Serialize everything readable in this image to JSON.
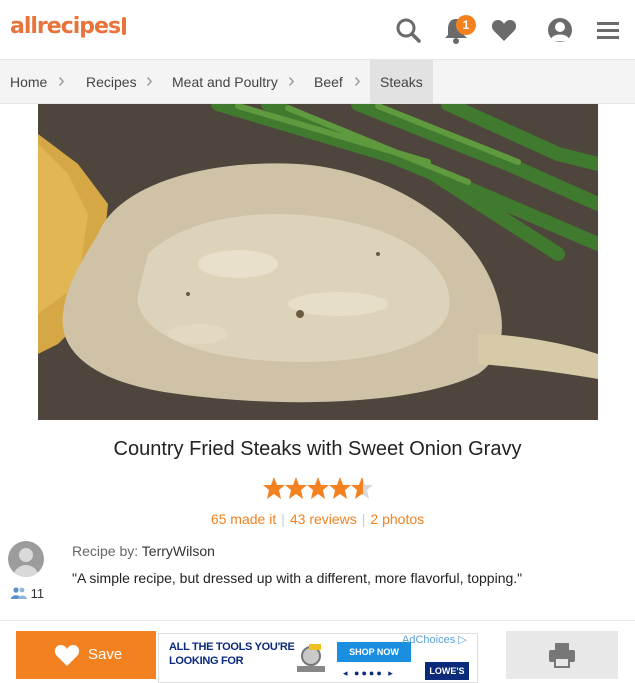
{
  "header": {
    "logo_text": "allrecipes",
    "notification_count": "1",
    "icons": [
      "search-icon",
      "bell-icon",
      "heart-icon",
      "user-icon",
      "menu-icon"
    ],
    "accent_color": "#f48120"
  },
  "breadcrumb": {
    "items": [
      "Home",
      "Recipes",
      "Meat and Poultry",
      "Beef",
      "Steaks"
    ]
  },
  "recipe": {
    "title": "Country Fried Steaks with Sweet Onion Gravy",
    "rating": 4.5,
    "made_it": "65 made it",
    "reviews": "43 reviews",
    "photos": "2 photos",
    "recipe_by_label": "Recipe by:",
    "author": "TerryWilson",
    "followers": "11",
    "description": "\"A simple recipe, but dressed up with a different, more flavorful, topping.\""
  },
  "bottom_bar": {
    "save_label": "Save",
    "ad": {
      "line1": "ALL THE TOOLS YOU'RE",
      "line2": "LOOKING FOR",
      "cta": "SHOP NOW",
      "brand": "LOWE'S",
      "adchoices": "AdChoices"
    }
  }
}
